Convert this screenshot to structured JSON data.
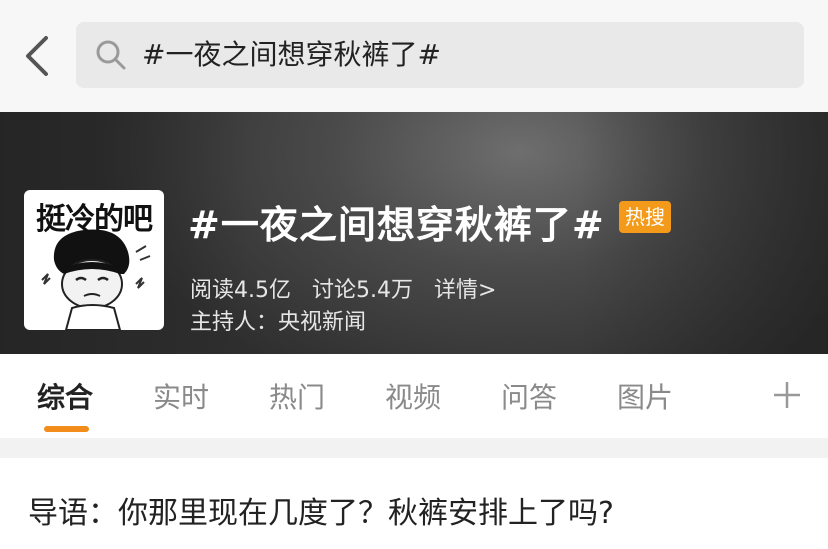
{
  "search": {
    "query": "#一夜之间想穿秋裤了#"
  },
  "topic": {
    "avatar_caption": "挺冷的吧",
    "title": "#一夜之间想穿秋裤了#",
    "badge": "热搜",
    "reads": "阅读4.5亿",
    "discussions": "讨论5.4万",
    "details_link": "详情>",
    "host": "主持人：央视新闻"
  },
  "tabs": [
    {
      "label": "综合",
      "active": true
    },
    {
      "label": "实时"
    },
    {
      "label": "热门"
    },
    {
      "label": "视频"
    },
    {
      "label": "问答"
    },
    {
      "label": "图片"
    }
  ],
  "lead_text": "导语：你那里现在几度了？秋裤安排上了吗?",
  "colors": {
    "accent": "#f28c1b",
    "badge": "#f39a1b",
    "hero_bg": "#4a4a4a"
  },
  "icons": [
    "back-arrow-icon",
    "search-icon",
    "plus-icon"
  ]
}
